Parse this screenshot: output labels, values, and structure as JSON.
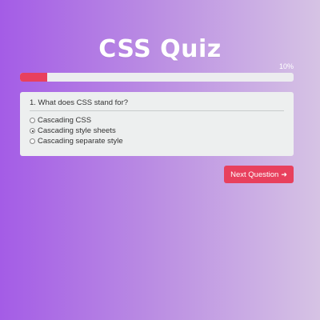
{
  "header": {
    "title": "CSS Quiz"
  },
  "progress": {
    "label": "10%",
    "value": 0.1,
    "color": "#e8405d",
    "track_color": "#ececef"
  },
  "quiz": {
    "question": "1. What does CSS stand for?",
    "options": [
      {
        "label": "Cascading CSS",
        "checked": false
      },
      {
        "label": "Cascading style sheets",
        "checked": true
      },
      {
        "label": "Cascading separate style",
        "checked": false
      }
    ]
  },
  "actions": {
    "next_label": "Next Question",
    "next_icon": "arrow-right-icon",
    "next_color": "#e8405d"
  }
}
